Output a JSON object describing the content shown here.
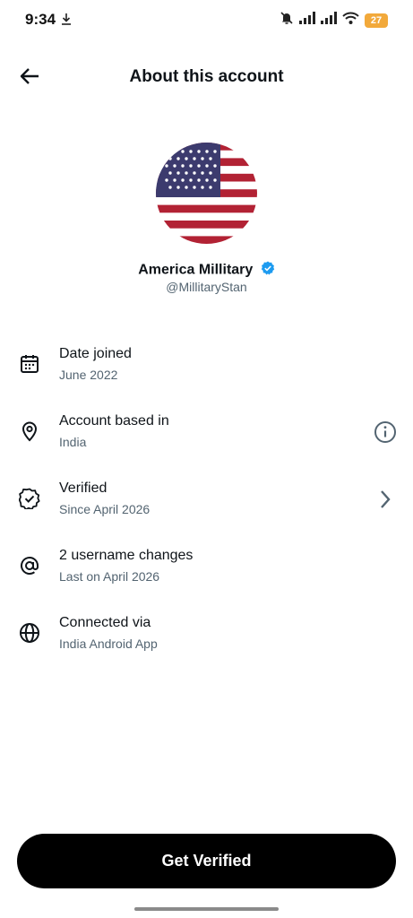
{
  "status_bar": {
    "time": "9:34",
    "battery": "27",
    "icons": [
      "download-icon",
      "bell-muted-icon",
      "signal-icon",
      "signal-icon",
      "wifi-icon",
      "battery-icon"
    ],
    "battery_color": "#f2a93b"
  },
  "header": {
    "title": "About this account",
    "back_icon": "arrow-left-icon"
  },
  "profile": {
    "display_name": "America Millitary",
    "handle": "@MillitaryStan",
    "verified_badge_color": "#1d9bf0",
    "avatar": "us-flag"
  },
  "info_rows": [
    {
      "icon": "calendar-icon",
      "title": "Date joined",
      "subtitle": "June 2022",
      "action": null
    },
    {
      "icon": "location-pin-icon",
      "title": "Account based in",
      "subtitle": "India",
      "action": "info-icon"
    },
    {
      "icon": "verified-badge-icon",
      "title": "Verified",
      "subtitle": "Since April 2026",
      "action": "chevron-right-icon"
    },
    {
      "icon": "at-sign-icon",
      "title": "2 username changes",
      "subtitle": "Last on April 2026",
      "action": null
    },
    {
      "icon": "globe-icon",
      "title": "Connected via",
      "subtitle": "India Android App",
      "action": null
    }
  ],
  "cta": {
    "label": "Get Verified",
    "color": "#000000"
  },
  "colors": {
    "text_primary": "#0f1419",
    "text_secondary": "#536471"
  }
}
